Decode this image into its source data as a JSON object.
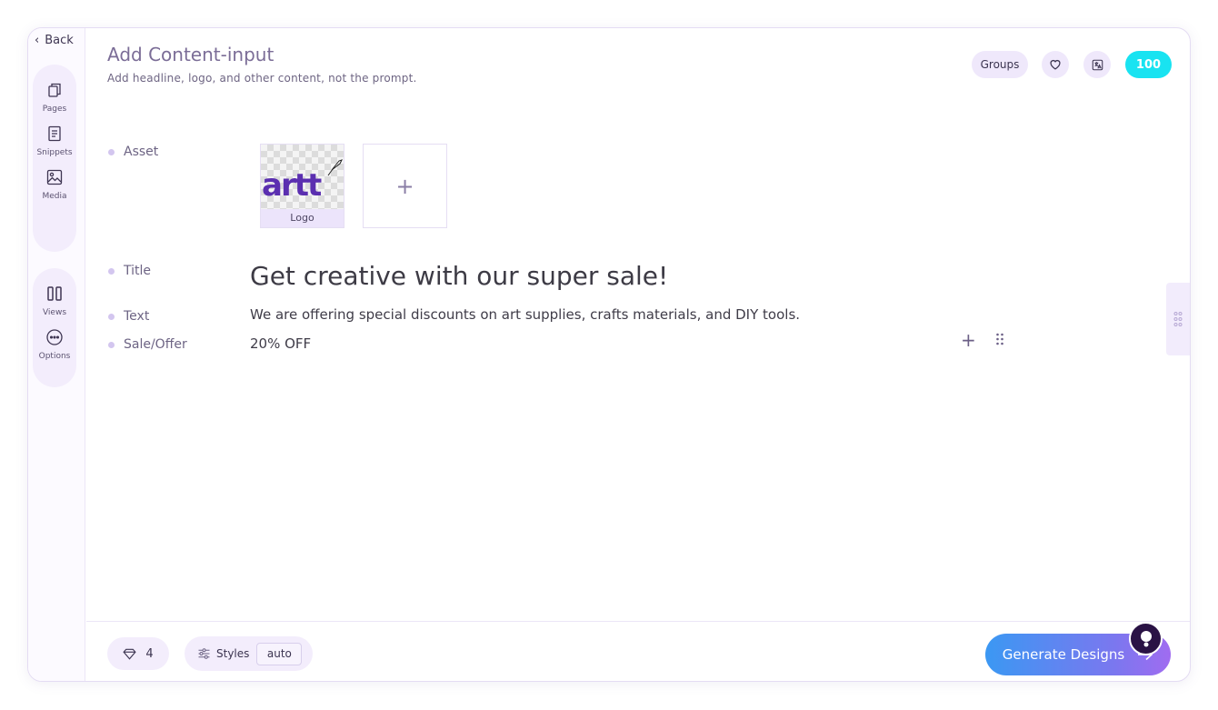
{
  "nav": {
    "back_label": "Back"
  },
  "sidebar": {
    "rail_top": [
      {
        "label": "Pages",
        "icon": "pages-icon"
      },
      {
        "label": "Snippets",
        "icon": "snippets-icon"
      },
      {
        "label": "Media",
        "icon": "media-icon"
      }
    ],
    "rail_bottom": [
      {
        "label": "Views",
        "icon": "views-icon"
      },
      {
        "label": "Options",
        "icon": "options-icon"
      }
    ]
  },
  "header": {
    "title": "Add Content-input",
    "subtitle": "Add headline, logo, and other content, not the prompt.",
    "groups_label": "Groups",
    "credits": "100"
  },
  "fields": {
    "asset_label": "Asset",
    "asset_card_label": "Logo",
    "asset_logo_text": "artt",
    "add_asset_label": "+",
    "title_label": "Title",
    "title_value": "Get creative with our super sale!",
    "text_label": "Text",
    "text_value": "We are offering special discounts on art supplies, crafts materials, and DIY tools.",
    "sale_label": "Sale/Offer",
    "sale_value": "20% OFF",
    "add_row_label": "+"
  },
  "footer": {
    "gem_count": "4",
    "styles_label": "Styles",
    "styles_value": "auto",
    "generate_label": "Generate Designs"
  },
  "colors": {
    "accent": "#19e3f1",
    "brand_purple": "#5b2fb0",
    "generate_start": "#3b98f3",
    "generate_end": "#a06cf0"
  }
}
